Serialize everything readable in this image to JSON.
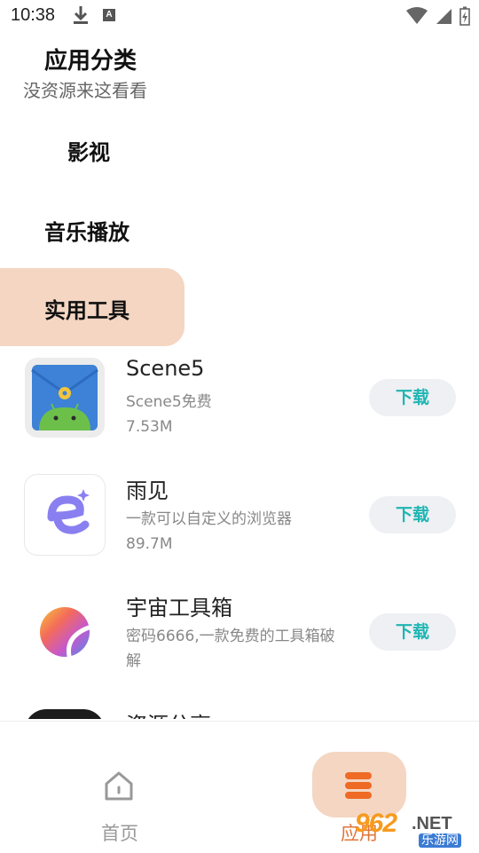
{
  "status_bar": {
    "time": "10:38",
    "notif_letter": "A"
  },
  "header": {
    "title": "应用分类",
    "subtitle": "没资源来这看看"
  },
  "categories": [
    {
      "label": "影视",
      "active": false
    },
    {
      "label": "音乐播放",
      "active": false
    },
    {
      "label": "实用工具",
      "active": true
    }
  ],
  "apps": [
    {
      "name": "Scene5",
      "desc": "Scene5免费",
      "size": "7.53M",
      "button": "下载"
    },
    {
      "name": "雨见",
      "desc": "一款可以自定义的浏览器",
      "size": "89.7M",
      "button": "下载"
    },
    {
      "name": "宇宙工具箱",
      "desc": "密码6666,一款免费的工具箱破解",
      "button": "下载"
    },
    {
      "name": "资源分享"
    }
  ],
  "bottom_nav": [
    {
      "label": "首页",
      "active": false
    },
    {
      "label": "应用",
      "active": true
    }
  ],
  "watermark": {
    "brand": "962",
    "tld": ".NET",
    "sub": "乐游网"
  },
  "colors": {
    "accent_bg": "#f4d6c3",
    "accent_text": "#e0753a",
    "download_text": "#1fb5b3"
  }
}
